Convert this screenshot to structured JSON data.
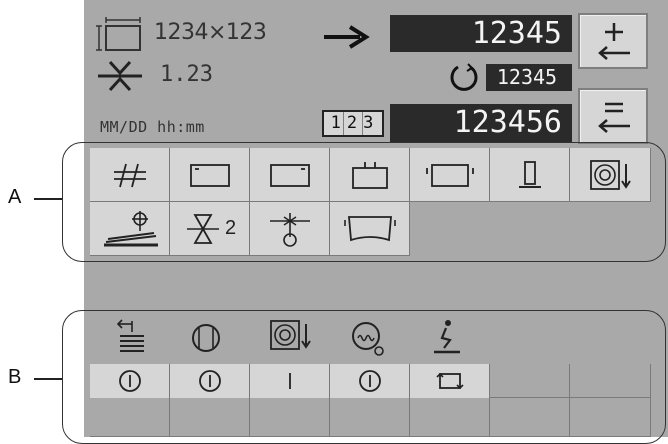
{
  "header": {
    "size_value": "1234×123",
    "gap_value": "1.23",
    "target_value": "12345",
    "rotation_value": "12345",
    "datetime_placeholder": "MM/DD hh:mm",
    "counter_badge": "123",
    "counter_value": "123456",
    "plus_symbol": "+",
    "minus_symbol": "−"
  },
  "callouts": {
    "a": "A",
    "b": "B"
  },
  "section_a": {
    "row1_icons": [
      "hash-icon",
      "box-corner-left-icon",
      "box-corner-right-icon",
      "box-top-tab-icon",
      "box-side-tabs-icon",
      "pedestal-icon",
      "roll-down-icon"
    ],
    "row2_icons": [
      "stack-sensor-icon",
      "hourglass-2-icon",
      "node-sensor-icon",
      "bent-box-icon"
    ],
    "hourglass_suffix": "2"
  },
  "section_b": {
    "status_icons": [
      "stack-arrow-icon",
      "circle-lines-icon",
      "roll-down-icon",
      "sensor-wave-icon",
      "person-sign-icon"
    ],
    "status_values": [
      "power-circle",
      "power-circle",
      "bar",
      "power-circle",
      "cycle"
    ]
  },
  "colors": {
    "panel": "#a9a9a9",
    "cell": "#d6d6d6",
    "display": "#2a2a2a"
  }
}
